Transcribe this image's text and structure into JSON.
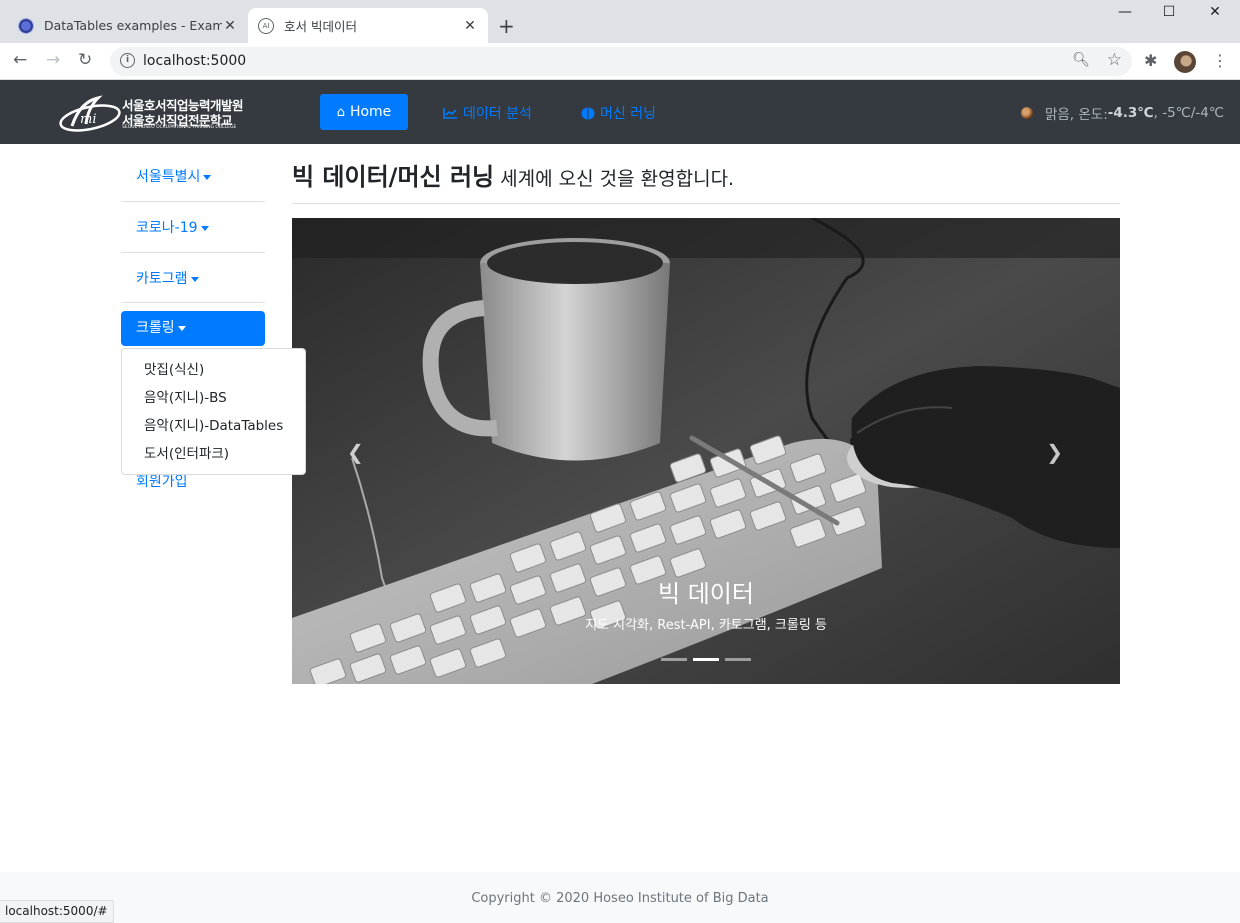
{
  "browser": {
    "tabs": [
      {
        "title": "DataTables examples - Examples"
      },
      {
        "title": "호서 빅데이터"
      }
    ],
    "url": "localhost:5000",
    "status_url": "localhost:5000/#"
  },
  "navbar": {
    "logo": {
      "line1": "서울호서직업능력개발원",
      "line2": "서울호서직업전문학교",
      "line3": "SEOUL HOSEO OCCUPATIONAL TRAINING COLLEGE"
    },
    "home_label": "Home",
    "links": [
      "데이터 분석",
      "머신 러닝"
    ],
    "weather": {
      "condition": "맑음, 온도: ",
      "temp": "-4.3℃",
      "range": ", -5℃/-4℃"
    }
  },
  "sidebar": {
    "items": [
      "서울특별시",
      "코로나-19",
      "카토그램"
    ],
    "active": "크롤링",
    "dropdown": [
      "맛집(식신)",
      "음악(지니)-BS",
      "음악(지니)-DataTables",
      "도서(인터파크)"
    ],
    "signup": "회원가입"
  },
  "main": {
    "title_bold": "빅 데이터/머신 러닝",
    "title_rest": " 세계에 오신 것을 환영합니다."
  },
  "carousel": {
    "caption_title": "빅 데이터",
    "caption_sub": "지도 시각화, Rest-API, 카토그램, 크롤링 등",
    "slides": 3,
    "active_slide": 2
  },
  "footer": {
    "text": "Copyright © 2020 Hoseo Institute of Big Data"
  }
}
